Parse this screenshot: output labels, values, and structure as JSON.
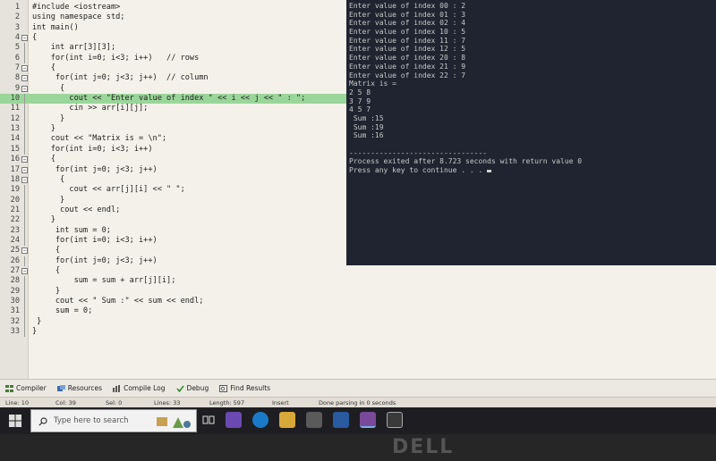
{
  "editor": {
    "lines": [
      {
        "n": "1",
        "fold": "",
        "t": "#include <iostream>"
      },
      {
        "n": "2",
        "fold": "",
        "t": "using namespace std;"
      },
      {
        "n": "3",
        "fold": "",
        "t": "int main()"
      },
      {
        "n": "4",
        "fold": "box",
        "t": "{"
      },
      {
        "n": "5",
        "fold": "line",
        "t": "    int arr[3][3];"
      },
      {
        "n": "6",
        "fold": "line",
        "t": "    for(int i=0; i<3; i++)   // rows"
      },
      {
        "n": "7",
        "fold": "box",
        "t": "    {"
      },
      {
        "n": "8",
        "fold": "box",
        "t": "     for(int j=0; j<3; j++)  // column"
      },
      {
        "n": "9",
        "fold": "box",
        "t": "      {"
      },
      {
        "n": "10",
        "fold": "line",
        "t": "        cout << \"Enter value of index \" << i << j << \" : \";",
        "hl": true
      },
      {
        "n": "11",
        "fold": "line",
        "t": "        cin >> arr[i][j];"
      },
      {
        "n": "12",
        "fold": "line",
        "t": "      }"
      },
      {
        "n": "13",
        "fold": "line",
        "t": "    }"
      },
      {
        "n": "14",
        "fold": "line",
        "t": "    cout << \"Matrix is = \\n\";"
      },
      {
        "n": "15",
        "fold": "line",
        "t": "    for(int i=0; i<3; i++)"
      },
      {
        "n": "16",
        "fold": "box",
        "t": "    {"
      },
      {
        "n": "17",
        "fold": "box",
        "t": "     for(int j=0; j<3; j++)"
      },
      {
        "n": "18",
        "fold": "box",
        "t": "      {"
      },
      {
        "n": "19",
        "fold": "line",
        "t": "        cout << arr[j][i] << \" \";"
      },
      {
        "n": "20",
        "fold": "line",
        "t": "      }"
      },
      {
        "n": "21",
        "fold": "line",
        "t": "      cout << endl;"
      },
      {
        "n": "22",
        "fold": "line",
        "t": "    }"
      },
      {
        "n": "23",
        "fold": "line",
        "t": "     int sum = 0;"
      },
      {
        "n": "24",
        "fold": "line",
        "t": "     for(int i=0; i<3; i++)"
      },
      {
        "n": "25",
        "fold": "box",
        "t": "     {"
      },
      {
        "n": "26",
        "fold": "line",
        "t": "     for(int j=0; j<3; j++)"
      },
      {
        "n": "27",
        "fold": "box",
        "t": "     {"
      },
      {
        "n": "28",
        "fold": "line",
        "t": "         sum = sum + arr[j][i];"
      },
      {
        "n": "29",
        "fold": "line",
        "t": "     }"
      },
      {
        "n": "30",
        "fold": "line",
        "t": "     cout << \" Sum :\" << sum << endl;"
      },
      {
        "n": "31",
        "fold": "line",
        "t": "     sum = 0;"
      },
      {
        "n": "32",
        "fold": "line",
        "t": " }"
      },
      {
        "n": "33",
        "fold": "line",
        "t": "}"
      }
    ]
  },
  "console": {
    "lines": [
      "Enter value of index 00 : 2",
      "Enter value of index 01 : 3",
      "Enter value of index 02 : 4",
      "Enter value of index 10 : 5",
      "Enter value of index 11 : 7",
      "Enter value of index 12 : 5",
      "Enter value of index 20 : 8",
      "Enter value of index 21 : 9",
      "Enter value of index 22 : 7",
      "Matrix is =",
      "2 5 8",
      "3 7 9",
      "4 5 7",
      " Sum :15",
      " Sum :19",
      " Sum :16",
      "",
      "--------------------------------",
      "Process exited after 8.723 seconds with return value 0",
      "Press any key to continue . . . "
    ]
  },
  "tabs": {
    "compiler": "Compiler",
    "resources": "Resources",
    "compile_log": "Compile Log",
    "debug": "Debug",
    "find_results": "Find Results"
  },
  "status": {
    "line": "Line:   10",
    "col": "Col:   39",
    "sel": "Sel:   0",
    "lines": "Lines:   33",
    "length": "Length:   597",
    "mode": "Insert",
    "message": "Done parsing in 0 seconds"
  },
  "taskbar": {
    "search_placeholder": "Type here to search"
  },
  "bezel": {
    "brand": "DELL"
  }
}
